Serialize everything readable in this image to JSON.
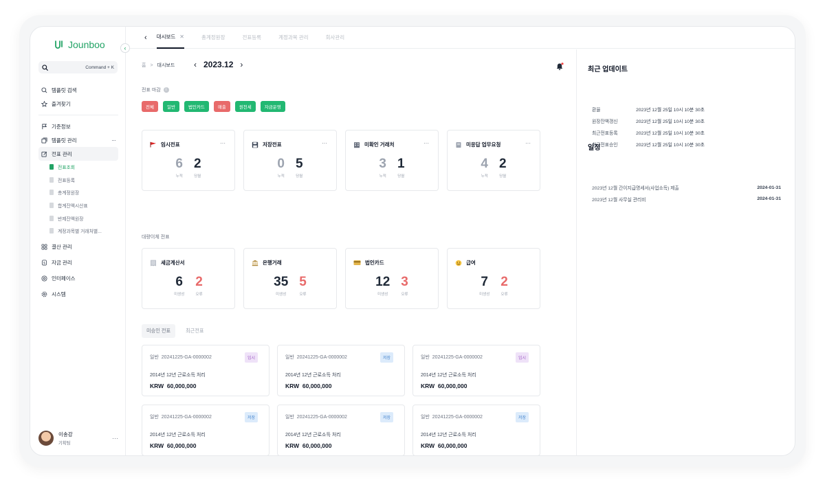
{
  "app": {
    "name": "Jounboo"
  },
  "search": {
    "shortcut": "Command + K"
  },
  "sidebar": {
    "top_items": [
      {
        "label": "템플릿 검색",
        "icon": "search-icon"
      },
      {
        "label": "즐겨찾기",
        "icon": "star-icon"
      }
    ],
    "items": [
      {
        "label": "기준정보",
        "icon": "flag-icon"
      },
      {
        "label": "템플릿 관리",
        "icon": "template-icon",
        "more": "···"
      },
      {
        "label": "전표 관리",
        "icon": "edit-icon"
      }
    ],
    "sub_items": [
      {
        "label": "전표조회",
        "active": true
      },
      {
        "label": "전표등록"
      },
      {
        "label": "총계정원장"
      },
      {
        "label": "합계잔액시산표"
      },
      {
        "label": "반제잔액원장"
      },
      {
        "label": "계정과목별 거래처별..."
      }
    ],
    "bottom_items": [
      {
        "label": "결산 관리",
        "icon": "grid-icon"
      },
      {
        "label": "자금 관리",
        "icon": "money-icon"
      },
      {
        "label": "인터페이스",
        "icon": "interface-icon"
      },
      {
        "label": "시스템",
        "icon": "gear-icon"
      }
    ],
    "user": {
      "name": "이송강",
      "role": "기획팀",
      "more": "···"
    }
  },
  "tabs": [
    {
      "label": "대시보드",
      "active": true,
      "close": "✕"
    },
    {
      "label": "총계정원장"
    },
    {
      "label": "전표등록"
    },
    {
      "label": "계정과목 관리"
    },
    {
      "label": "회사관리"
    }
  ],
  "breadcrumb": {
    "home": "홈",
    "sep": ">",
    "current": "대시보드"
  },
  "period": {
    "value": "2023.12"
  },
  "closing": {
    "label": "전표 마감",
    "info": "i",
    "chips": [
      {
        "label": "전체",
        "color": "#e86a6a"
      },
      {
        "label": "일반",
        "color": "#22b872"
      },
      {
        "label": "법인카드",
        "color": "#22b872"
      },
      {
        "label": "매출",
        "color": "#e86a6a"
      },
      {
        "label": "원천세",
        "color": "#22b872"
      },
      {
        "label": "자금운영",
        "color": "#22b872"
      }
    ]
  },
  "stat_cards": [
    {
      "title": "임시전표",
      "icon": "red-flag-icon",
      "dots": "···",
      "a": {
        "value": "6",
        "label": "누적"
      },
      "b": {
        "value": "2",
        "label": "당월"
      }
    },
    {
      "title": "저장전표",
      "icon": "floppy-disk-icon",
      "dots": "···",
      "a": {
        "value": "0",
        "label": "누적"
      },
      "b": {
        "value": "5",
        "label": "당월"
      }
    },
    {
      "title": "미확인 거래처",
      "icon": "building-icon",
      "dots": "···",
      "a": {
        "value": "3",
        "label": "누적"
      },
      "b": {
        "value": "1",
        "label": "당월"
      }
    },
    {
      "title": "미응답 업무요청",
      "icon": "notebook-icon",
      "dots": "···",
      "a": {
        "value": "4",
        "label": "누적"
      },
      "b": {
        "value": "2",
        "label": "당월"
      }
    }
  ],
  "bulk": {
    "label": "대량이체 전표",
    "cards": [
      {
        "title": "세금계산서",
        "icon": "receipt-icon",
        "a": {
          "value": "6",
          "label": "미생성"
        },
        "b": {
          "value": "2",
          "label": "오류"
        }
      },
      {
        "title": "은행거래",
        "icon": "bank-icon",
        "a": {
          "value": "35",
          "label": "미생성"
        },
        "b": {
          "value": "5",
          "label": "오류"
        }
      },
      {
        "title": "법인카드",
        "icon": "credit-card-icon",
        "a": {
          "value": "12",
          "label": "미생성"
        },
        "b": {
          "value": "3",
          "label": "오류"
        }
      },
      {
        "title": "급여",
        "icon": "smile-icon",
        "a": {
          "value": "7",
          "label": "미생성"
        },
        "b": {
          "value": "2",
          "label": "오류"
        }
      }
    ]
  },
  "voucher_tabs": [
    {
      "label": "미승인 전표",
      "active": true
    },
    {
      "label": "최근전표"
    }
  ],
  "vouchers": [
    {
      "type": "일반",
      "code": "20241225-GA-0000002",
      "badge": "임시",
      "badge_kind": "temp",
      "title": "2014년 12년 근로소득 처리",
      "currency": "KRW",
      "amount": "60,000,000"
    },
    {
      "type": "일반",
      "code": "20241225-GA-0000002",
      "badge": "저장",
      "badge_kind": "save",
      "title": "2014년 12년 근로소득 처리",
      "currency": "KRW",
      "amount": "60,000,000"
    },
    {
      "type": "일반",
      "code": "20241225-GA-0000002",
      "badge": "임시",
      "badge_kind": "temp",
      "title": "2014년 12년 근로소득 처리",
      "currency": "KRW",
      "amount": "60,000,000"
    },
    {
      "type": "일반",
      "code": "20241225-GA-0000002",
      "badge": "저장",
      "badge_kind": "save",
      "title": "2014년 12년 근로소득 처리",
      "currency": "KRW",
      "amount": "60,000,000"
    },
    {
      "type": "일반",
      "code": "20241225-GA-0000002",
      "badge": "저장",
      "badge_kind": "save",
      "title": "2014년 12년 근로소득 처리",
      "currency": "KRW",
      "amount": "60,000,000"
    },
    {
      "type": "일반",
      "code": "20241225-GA-0000002",
      "badge": "저장",
      "badge_kind": "save",
      "title": "2014년 12년 근로소득 처리",
      "currency": "KRW",
      "amount": "60,000,000"
    }
  ],
  "updates": {
    "title": "최근 업데이트",
    "rows": [
      {
        "k": "환율",
        "v": "2023년 12월 25일 10시 10분 30초"
      },
      {
        "k": "원장잔액갱신",
        "v": "2023년 12월 25일 10시 10분 30초"
      },
      {
        "k": "최근전표등록",
        "v": "2023년 12월 25일 10시 10분 30초"
      },
      {
        "k": "최근전표승인",
        "v": "2023년 12월 25일 10시 10분 30초"
      }
    ]
  },
  "schedule": {
    "title": "일정",
    "rows": [
      {
        "text": "2023년 12월 간이지급명세서(사업소득) 제출",
        "date": "2024-01-31"
      },
      {
        "text": "2023년 12월 사무실 관리비",
        "date": "2024-01-31"
      }
    ]
  }
}
